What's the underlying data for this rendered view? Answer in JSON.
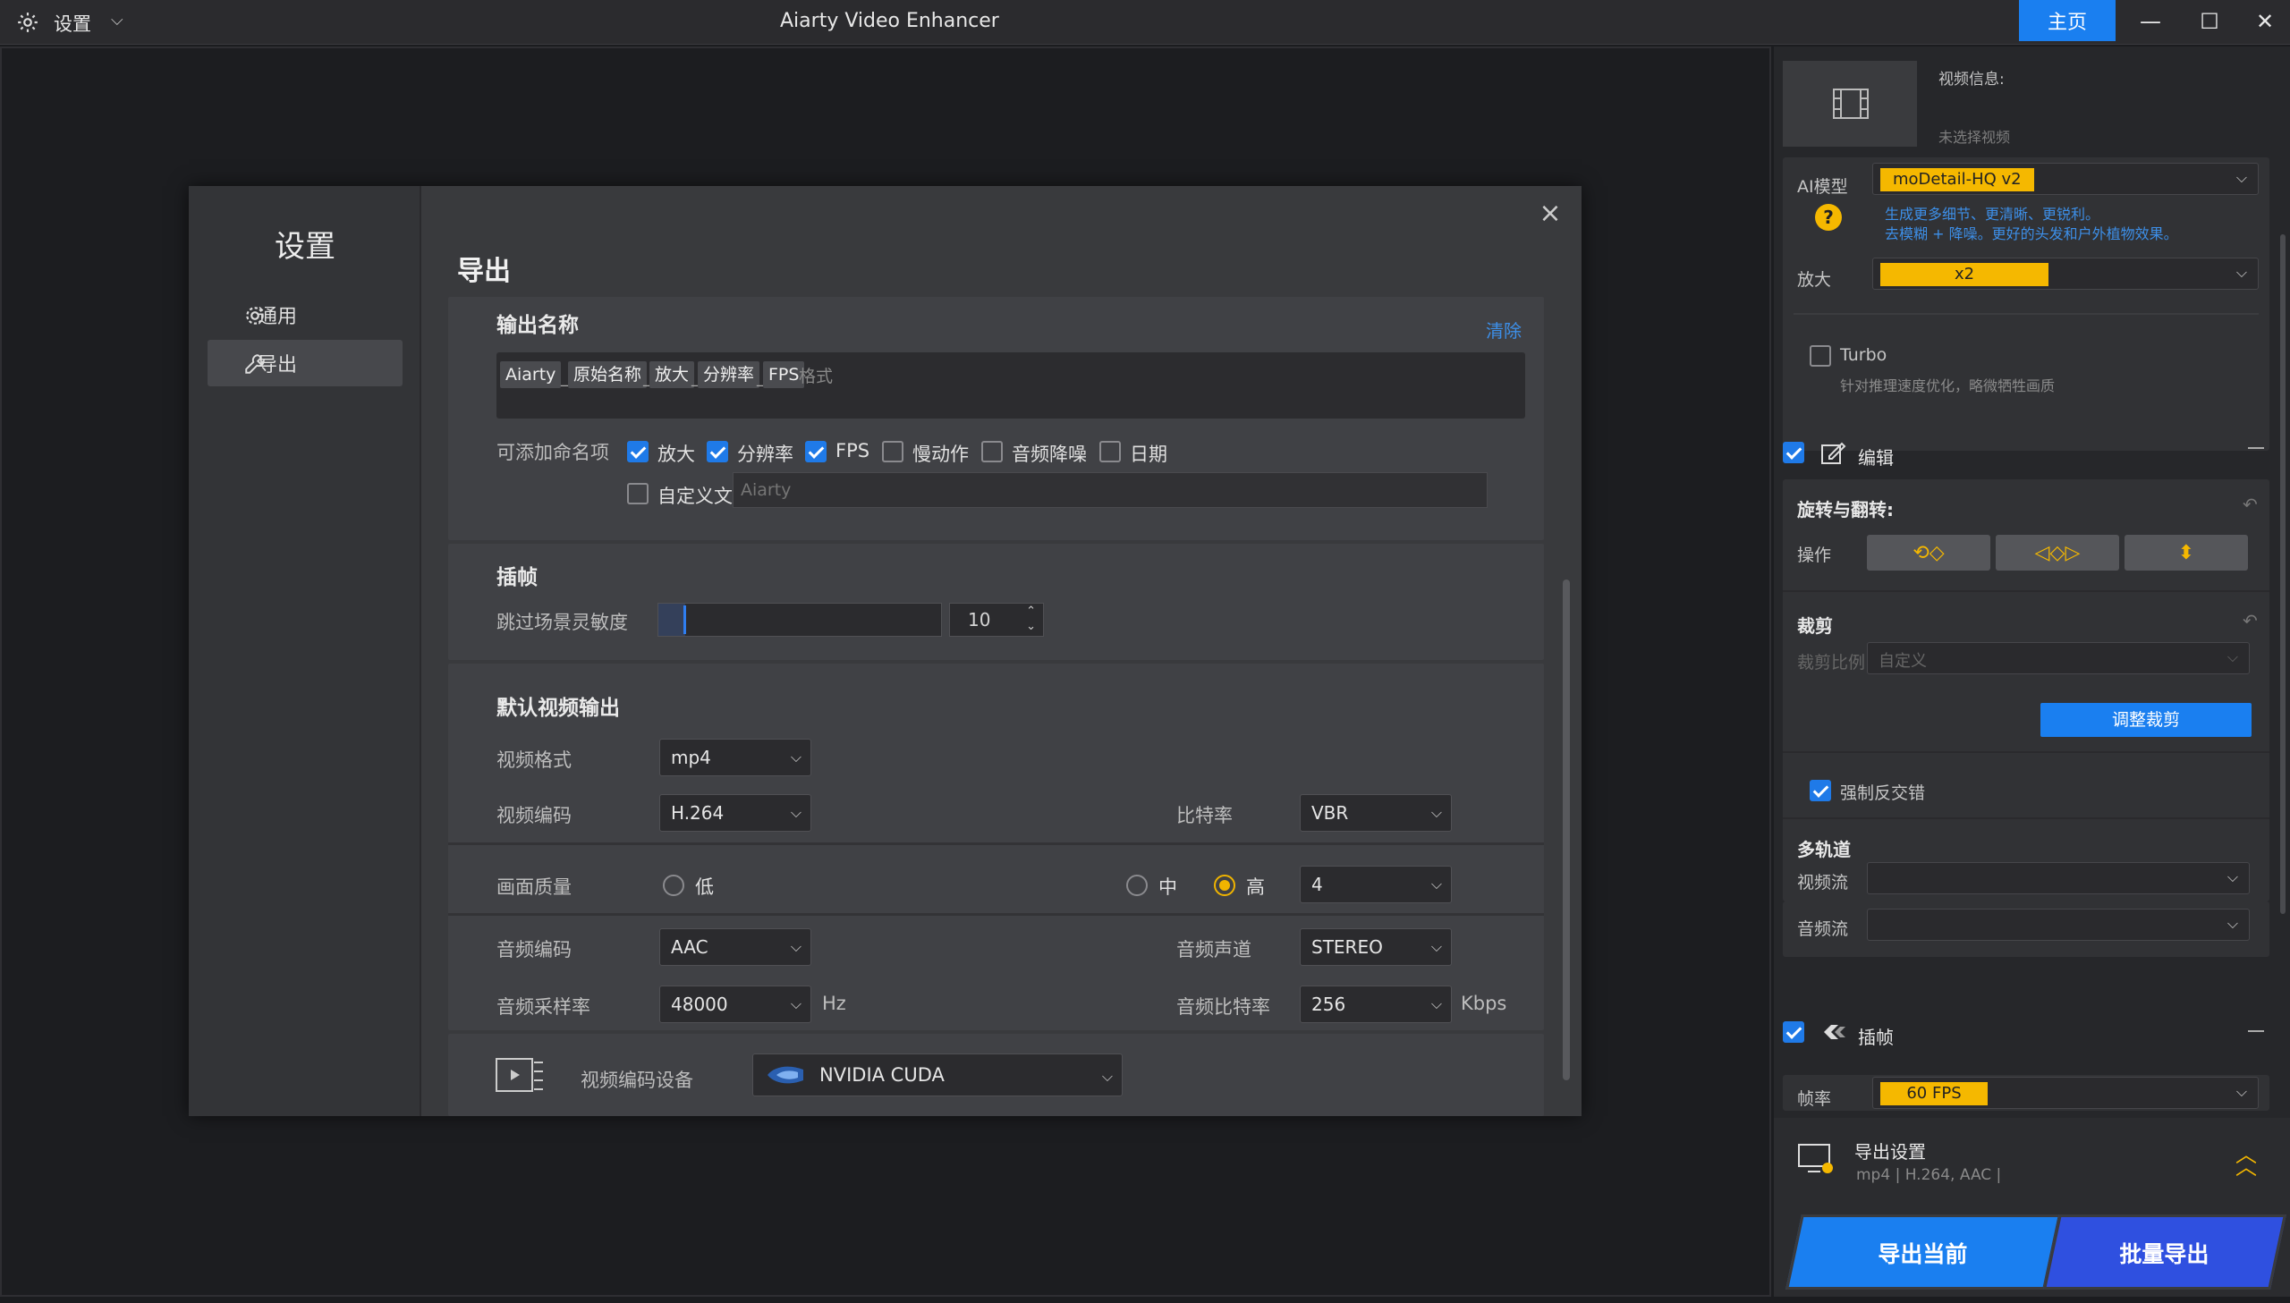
{
  "titlebar": {
    "settings_label": "设置",
    "app_title": "Aiarty Video Enhancer",
    "home_label": "主页",
    "minimize": "—",
    "maximize": "☐",
    "close": "✕"
  },
  "modal": {
    "sidebar_title": "设置",
    "nav": [
      {
        "label": "通用",
        "icon": "gear-icon"
      },
      {
        "label": "导出",
        "icon": "wrench-icon"
      }
    ],
    "page_title": "导出",
    "output_name": {
      "header": "输出名称",
      "clear_label": "清除",
      "tags": [
        "Aiarty",
        "原始名称",
        "放大",
        "分辨率",
        "FPS"
      ],
      "separator": "_",
      "format_hint": "格式",
      "addable_label": "可添加命名项",
      "options": [
        {
          "label": "放大",
          "checked": true
        },
        {
          "label": "分辨率",
          "checked": true
        },
        {
          "label": "FPS",
          "checked": true
        },
        {
          "label": "慢动作",
          "checked": false
        },
        {
          "label": "音频降噪",
          "checked": false
        },
        {
          "label": "日期",
          "checked": false
        }
      ],
      "custom_text_label": "自定义文字",
      "custom_text_placeholder": "Aiarty"
    },
    "interp": {
      "header": "插帧",
      "skip_label": "跳过场景灵敏度",
      "value": "10"
    },
    "default_output": {
      "header": "默认视频输出",
      "format_label": "视频格式",
      "format_value": "mp4",
      "codec_label": "视频编码",
      "codec_value": "H.264",
      "bitrate_label": "比特率",
      "bitrate_value": "VBR",
      "quality_label": "画面质量",
      "quality_options": [
        "低",
        "中",
        "高"
      ],
      "quality_selected": "高",
      "quality_value": "4",
      "audio_codec_label": "音频编码",
      "audio_codec_value": "AAC",
      "audio_channel_label": "音频声道",
      "audio_channel_value": "STEREO",
      "sample_rate_label": "音频采样率",
      "sample_rate_value": "48000",
      "sample_rate_unit": "Hz",
      "audio_bitrate_label": "音频比特率",
      "audio_bitrate_value": "256",
      "audio_bitrate_unit": "Kbps"
    },
    "device": {
      "label": "视频编码设备",
      "value": "NVIDIA CUDA"
    }
  },
  "right_panel": {
    "video_info_label": "视频信息:",
    "no_video": "未选择视频",
    "ai_model_label": "AI模型",
    "ai_model_value": "moDetail-HQ  v2",
    "ai_desc_1": "生成更多细节、更清晰、更锐利。",
    "ai_desc_2": "去模糊 + 降噪。更好的头发和户外植物效果。",
    "scale_label": "放大",
    "scale_value": "x2",
    "turbo_label": "Turbo",
    "turbo_desc": "针对推理速度优化，略微牺牲画质",
    "edit_label": "编辑",
    "rotate_header": "旋转与翻转:",
    "operate_label": "操作",
    "crop_header": "裁剪",
    "crop_ratio_label": "裁剪比例",
    "crop_ratio_value": "自定义",
    "adjust_crop_label": "调整裁剪",
    "deinterlace_label": "强制反交错",
    "multitrack_header": "多轨道",
    "video_stream_label": "视频流",
    "audio_stream_label": "音频流",
    "interp_label": "插帧",
    "fps_label": "帧率",
    "fps_value": "60 FPS",
    "export_settings_label": "导出设置",
    "export_settings_desc": "mp4 | H.264, AAC |",
    "export_current_label": "导出当前",
    "batch_export_label": "批量导出",
    "accent": "#1a7ff0",
    "highlight": "#f5b800"
  }
}
